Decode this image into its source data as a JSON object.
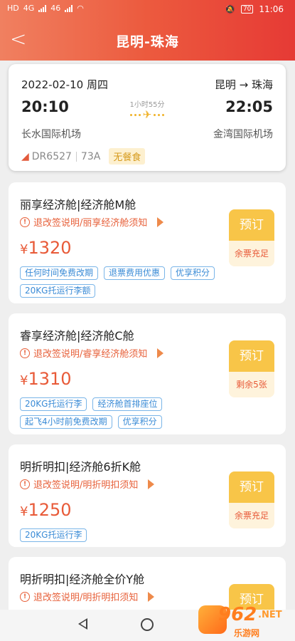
{
  "status_bar": {
    "left_labels": [
      "HD",
      "4G",
      "46",
      "46"
    ],
    "silent": true,
    "battery": "70",
    "time": "11:06"
  },
  "nav": {
    "title": "昆明-珠海"
  },
  "flight": {
    "date": "2022-02-10 周四",
    "route": "昆明 → 珠海",
    "dep_time": "20:10",
    "arr_time": "22:05",
    "duration": "1小时55分",
    "dep_airport": "长水国际机场",
    "arr_airport": "金湾国际机场",
    "flight_no": "DR6527",
    "aircraft": "73A",
    "meal": "无餐食"
  },
  "cabins": [
    {
      "name": "丽享经济舱|经济舱M舱",
      "rule": "退改签说明/丽享经济舱须知",
      "currency": "¥",
      "price": "1320",
      "tags": [
        "任何时间免费改期",
        "退票费用优惠",
        "优享积分",
        "20KG托运行李额"
      ],
      "book": "预订",
      "stock": "余票充足"
    },
    {
      "name": "睿享经济舱|经济舱C舱",
      "rule": "退改签说明/睿享经济舱须知",
      "currency": "¥",
      "price": "1310",
      "tags": [
        "20KG托运行李",
        "经济舱首排座位",
        "起飞4小时前免费改期",
        "优享积分"
      ],
      "book": "预订",
      "stock": "剩余5张"
    },
    {
      "name": "明折明扣|经济舱6折K舱",
      "rule": "退改签说明/明折明扣须知",
      "currency": "¥",
      "price": "1250",
      "tags": [
        "20KG托运行李"
      ],
      "book": "预订",
      "stock": "余票充足"
    },
    {
      "name": "明折明扣|经济舱全价Y舱",
      "rule": "退改签说明/明折明扣须知",
      "currency": "¥",
      "price": "",
      "tags": [],
      "book": "预订",
      "stock": ""
    }
  ],
  "watermark": {
    "number": "962",
    "net": ".NET",
    "text": "乐游网"
  },
  "colors": {
    "header_start": "#f08060",
    "header_end": "#e63a35",
    "price": "#e85a38",
    "book_button": "#f8c548",
    "tag": "#3a8bd6"
  }
}
